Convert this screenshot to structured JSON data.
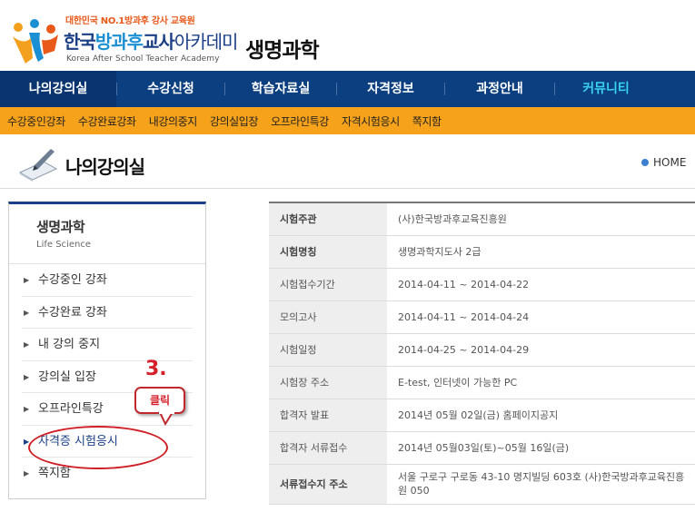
{
  "header": {
    "tagline": "대한민국 NO.1방과후 강사 교육원",
    "logo_part1": "한국",
    "logo_part2": "방과후",
    "logo_part3": "교사",
    "logo_part4": "아카데미",
    "logo_sub": "Korea After School Teacher Academy",
    "site_title": "생명과학"
  },
  "main_nav": {
    "items": [
      "나의강의실",
      "수강신청",
      "학습자료실",
      "자격정보",
      "과정안내",
      "커뮤니티"
    ]
  },
  "sub_nav": {
    "items": [
      "수강중인강좌",
      "수강완료강좌",
      "내강의중지",
      "강의실입장",
      "오프라인특강",
      "자격시험응시",
      "쪽지함"
    ]
  },
  "page": {
    "title": "나의강의실",
    "home": "HOME"
  },
  "sidebar": {
    "title": "생명과학",
    "subtitle": "Life Science",
    "items": [
      "수강중인 강좌",
      "수강완료 강좌",
      "내 강의 중지",
      "강의실 입장",
      "오프라인특강",
      "자격증 시험응시",
      "쪽지함"
    ],
    "arrow": "▶"
  },
  "annotation": {
    "step": "3.",
    "callout": "클릭"
  },
  "info": {
    "rows": [
      {
        "label": "시험주관",
        "value": "(사)한국방과후교육진흥원"
      },
      {
        "label": "시험명칭",
        "value": "생명과학지도사 2급"
      },
      {
        "label": "시험접수기간",
        "value": "2014-04-11 ~ 2014-04-22"
      },
      {
        "label": "모의고사",
        "value": "2014-04-11 ~ 2014-04-24"
      },
      {
        "label": "시험일정",
        "value": "2014-04-25 ~ 2014-04-29"
      },
      {
        "label": "시험장 주소",
        "value": "E-test, 인터넷이 가능한 PC"
      },
      {
        "label": "합격자 발표",
        "value": "2014년 05월 02일(금) 홈페이지공지"
      },
      {
        "label": "합격자 서류접수",
        "value": "2014년 05월03일(토)~05월 16일(금)"
      },
      {
        "label": "서류접수지 주소",
        "value": "서울 구로구 구로동 43-10 명지빌딩 603호 (사)한국방과후교육진흥원 050"
      }
    ]
  },
  "colors": {
    "nav_bg": "#0b3f80",
    "sub_nav_bg": "#f7a21b",
    "highlight_text": "#3ad3f0",
    "annotation_red": "#d4202a"
  }
}
